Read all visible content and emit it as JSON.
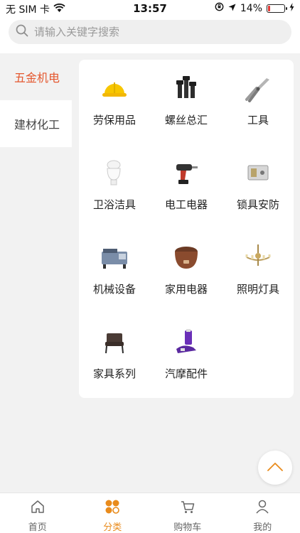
{
  "status_bar": {
    "carrier": "无 SIM 卡",
    "time": "13:57",
    "battery_percent": "14%",
    "battery_level": 0.14,
    "battery_color": "#e53935"
  },
  "search": {
    "placeholder": "请输入关键字搜索",
    "icon": "search-icon"
  },
  "sidebar": {
    "items": [
      {
        "label": "五金机电",
        "active": true
      },
      {
        "label": "建材化工",
        "active": false
      }
    ],
    "active_color": "#e4572e"
  },
  "categories": [
    {
      "label": "劳保用品",
      "icon": "hard-hat-icon"
    },
    {
      "label": "螺丝总汇",
      "icon": "bolts-icon"
    },
    {
      "label": "工具",
      "icon": "pliers-icon"
    },
    {
      "label": "卫浴洁具",
      "icon": "toilet-icon"
    },
    {
      "label": "电工电器",
      "icon": "drill-icon"
    },
    {
      "label": "锁具安防",
      "icon": "lock-icon"
    },
    {
      "label": "机械设备",
      "icon": "machine-icon"
    },
    {
      "label": "家用电器",
      "icon": "rice-cooker-icon"
    },
    {
      "label": "照明灯具",
      "icon": "chandelier-icon"
    },
    {
      "label": "家具系列",
      "icon": "chair-icon"
    },
    {
      "label": "汽摩配件",
      "icon": "car-parts-icon"
    }
  ],
  "tabbar": {
    "items": [
      {
        "label": "首页",
        "icon": "home-icon"
      },
      {
        "label": "分类",
        "icon": "category-icon"
      },
      {
        "label": "购物车",
        "icon": "cart-icon"
      },
      {
        "label": "我的",
        "icon": "user-icon"
      }
    ],
    "active_index": 1,
    "active_color": "#e98b1c"
  }
}
